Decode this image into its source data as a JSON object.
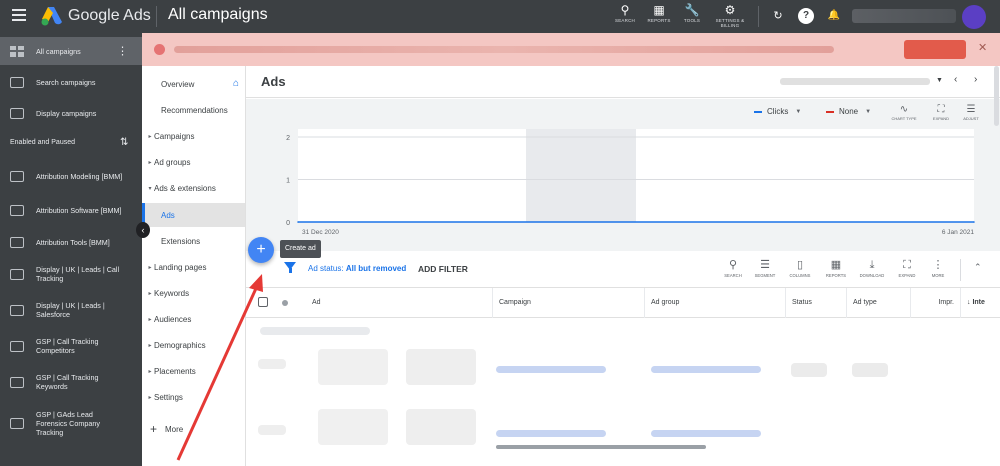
{
  "header": {
    "brand": "Google Ads",
    "title": "All campaigns",
    "tools": [
      {
        "icon": "search-icon",
        "label": "SEARCH"
      },
      {
        "icon": "reports-icon",
        "label": "REPORTS"
      },
      {
        "icon": "wrench-icon",
        "label": "TOOLS"
      },
      {
        "icon": "gear-icon",
        "label": "SETTINGS & BILLING"
      }
    ]
  },
  "sidebar": {
    "all_campaigns": "All campaigns",
    "search_campaigns": "Search campaigns",
    "display_campaigns": "Display campaigns",
    "filter_label": "Enabled and Paused",
    "campaigns": [
      "Attribution Modeling [BMM]",
      "Attribution Software [BMM]",
      "Attribution Tools [BMM]",
      "Display | UK | Leads | Call Tracking",
      "Display | UK | Leads | Salesforce",
      "GSP | Call Tracking Competitors",
      "GSP | Call Tracking Keywords",
      "GSP | GAds Lead Forensics Company Tracking"
    ]
  },
  "section_nav": {
    "items": [
      "Overview",
      "Recommendations",
      "Campaigns",
      "Ad groups",
      "Ads & extensions",
      "Ads",
      "Extensions",
      "Landing pages",
      "Keywords",
      "Audiences",
      "Demographics",
      "Placements",
      "Settings"
    ],
    "more": "More"
  },
  "main": {
    "title": "Ads",
    "chart": {
      "metric1": "Clicks",
      "metric2": "None",
      "tools": [
        "CHART TYPE",
        "EXPAND",
        "ADJUST"
      ],
      "colors": {
        "clicks": "#1a73e8",
        "none": "#d93025"
      }
    },
    "create_tooltip": "Create ad",
    "filter": {
      "prefix": "Ad status:",
      "value": "All but removed",
      "add": "ADD FILTER"
    },
    "table_tools": [
      "SEARCH",
      "SEGMENT",
      "COLUMNS",
      "REPORTS",
      "DOWNLOAD",
      "EXPAND",
      "MORE"
    ],
    "columns": [
      "Ad",
      "Campaign",
      "Ad group",
      "Status",
      "Ad type",
      "Impr.",
      "Inte"
    ]
  },
  "chart_data": {
    "type": "line",
    "series": [
      {
        "name": "Clicks",
        "values": [
          0,
          0
        ]
      }
    ],
    "x": [
      "31 Dec 2020",
      "6 Jan 2021"
    ],
    "yticks": [
      0,
      1,
      2
    ],
    "ylim": [
      0,
      2
    ],
    "grid": true
  }
}
